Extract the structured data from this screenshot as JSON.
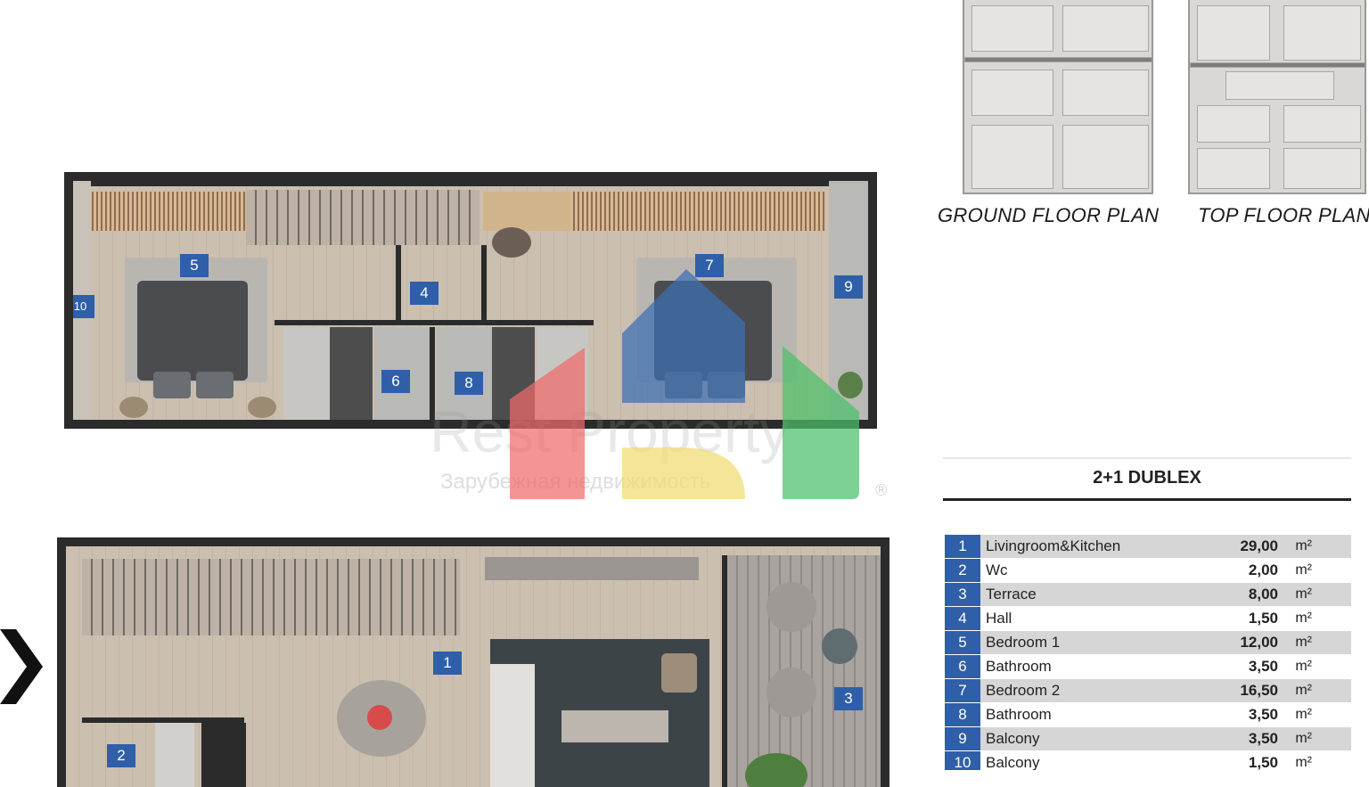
{
  "thumbnails": {
    "ground_caption": "GROUND FLOOR PLAN",
    "top_caption": "TOP FLOOR PLAN"
  },
  "top_plan_markers": [
    "5",
    "4",
    "7",
    "9",
    "10",
    "6",
    "8"
  ],
  "ground_plan_markers": [
    "1",
    "2",
    "3"
  ],
  "nav": {
    "arrow_icon": "chevron-right-icon"
  },
  "watermark": {
    "brand": "Rest Property",
    "tagline": "Зарубежная недвижимость",
    "reg_mark": "®",
    "colors": {
      "red": "#f06b6b",
      "blue": "#3d6fb3",
      "yellow": "#f2dc72",
      "green": "#4cc06a"
    }
  },
  "table": {
    "title": "2+1 DUBLEX",
    "rows": [
      {
        "no": "1",
        "room": "Livingroom&Kitchen",
        "area": "29,00",
        "unit": "m²"
      },
      {
        "no": "2",
        "room": "Wc",
        "area": "2,00",
        "unit": "m²"
      },
      {
        "no": "3",
        "room": "Terrace",
        "area": "8,00",
        "unit": "m²"
      },
      {
        "no": "4",
        "room": "Hall",
        "area": "1,50",
        "unit": "m²"
      },
      {
        "no": "5",
        "room": "Bedroom 1",
        "area": "12,00",
        "unit": "m²"
      },
      {
        "no": "6",
        "room": "Bathroom",
        "area": "3,50",
        "unit": "m²"
      },
      {
        "no": "7",
        "room": "Bedroom 2",
        "area": "16,50",
        "unit": "m²"
      },
      {
        "no": "8",
        "room": "Bathroom",
        "area": "3,50",
        "unit": "m²"
      },
      {
        "no": "9",
        "room": "Balcony",
        "area": "3,50",
        "unit": "m²"
      },
      {
        "no": "10",
        "room": "Balcony",
        "area": "1,50",
        "unit": "m²"
      }
    ]
  }
}
